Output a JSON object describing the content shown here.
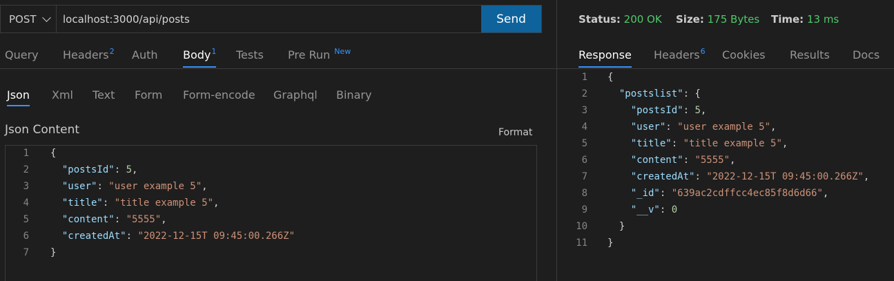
{
  "request": {
    "method": "POST",
    "url": "localhost:3000/api/posts",
    "send_label": "Send"
  },
  "request_tabs": [
    {
      "label": "Query"
    },
    {
      "label": "Headers",
      "badge": "2"
    },
    {
      "label": "Auth"
    },
    {
      "label": "Body",
      "badge": "1",
      "active": true
    },
    {
      "label": "Tests"
    },
    {
      "label": "Pre Run",
      "badge": "New"
    }
  ],
  "body_tabs": [
    {
      "label": "Json",
      "active": true
    },
    {
      "label": "Xml"
    },
    {
      "label": "Text"
    },
    {
      "label": "Form"
    },
    {
      "label": "Form-encode"
    },
    {
      "label": "Graphql"
    },
    {
      "label": "Binary"
    }
  ],
  "json_content_label": "Json Content",
  "format_label": "Format",
  "request_body_lines": [
    {
      "n": "1",
      "text": "{"
    },
    {
      "n": "2",
      "key": "\"postsId\"",
      "value": "5",
      "type": "num",
      "indent": "  ",
      "trail": ","
    },
    {
      "n": "3",
      "key": "\"user\"",
      "value": "\"user example 5\"",
      "type": "str",
      "indent": "  ",
      "trail": ","
    },
    {
      "n": "4",
      "key": "\"title\"",
      "value": "\"title example 5\"",
      "type": "str",
      "indent": "  ",
      "trail": ","
    },
    {
      "n": "5",
      "key": "\"content\"",
      "value": "\"5555\"",
      "type": "str",
      "indent": "  ",
      "trail": ","
    },
    {
      "n": "6",
      "key": "\"createdAt\"",
      "value": "\"2022-12-15T 09:45:00.266Z\"",
      "type": "str",
      "indent": "  ",
      "trail": ""
    },
    {
      "n": "7",
      "text": "}"
    }
  ],
  "status": {
    "status_label": "Status:",
    "status_value": "200 OK",
    "size_label": "Size:",
    "size_value": "175 Bytes",
    "time_label": "Time:",
    "time_value": "13 ms"
  },
  "response_tabs": [
    {
      "label": "Response",
      "active": true
    },
    {
      "label": "Headers",
      "badge": "6"
    },
    {
      "label": "Cookies"
    },
    {
      "label": "Results"
    },
    {
      "label": "Docs"
    }
  ],
  "response_lines": [
    {
      "n": "1",
      "text": "{"
    },
    {
      "n": "2",
      "key": "\"postslist\"",
      "text_after": ": {",
      "indent": "  "
    },
    {
      "n": "3",
      "key": "\"postsId\"",
      "value": "5",
      "type": "num",
      "indent": "    ",
      "trail": ","
    },
    {
      "n": "4",
      "key": "\"user\"",
      "value": "\"user example 5\"",
      "type": "str",
      "indent": "    ",
      "trail": ","
    },
    {
      "n": "5",
      "key": "\"title\"",
      "value": "\"title example 5\"",
      "type": "str",
      "indent": "    ",
      "trail": ","
    },
    {
      "n": "6",
      "key": "\"content\"",
      "value": "\"5555\"",
      "type": "str",
      "indent": "    ",
      "trail": ","
    },
    {
      "n": "7",
      "key": "\"createdAt\"",
      "value": "\"2022-12-15T 09:45:00.266Z\"",
      "type": "str",
      "indent": "    ",
      "trail": ","
    },
    {
      "n": "8",
      "key": "\"_id\"",
      "value": "\"639ac2cdffcc4ec85f8d6d66\"",
      "type": "str",
      "indent": "    ",
      "trail": ","
    },
    {
      "n": "9",
      "key": "\"__v\"",
      "value": "0",
      "type": "num",
      "indent": "    ",
      "trail": ""
    },
    {
      "n": "10",
      "text": "  }"
    },
    {
      "n": "11",
      "text": "}"
    }
  ],
  "colors": {
    "accent": "#0e639c",
    "active_tab_underline": "#3794ff",
    "status_value": "#4ec96a",
    "json_key": "#9cdcfe",
    "json_string": "#ce9178",
    "json_number": "#b5cea8"
  },
  "icons": {
    "method_dropdown": "chevron-down-icon"
  }
}
